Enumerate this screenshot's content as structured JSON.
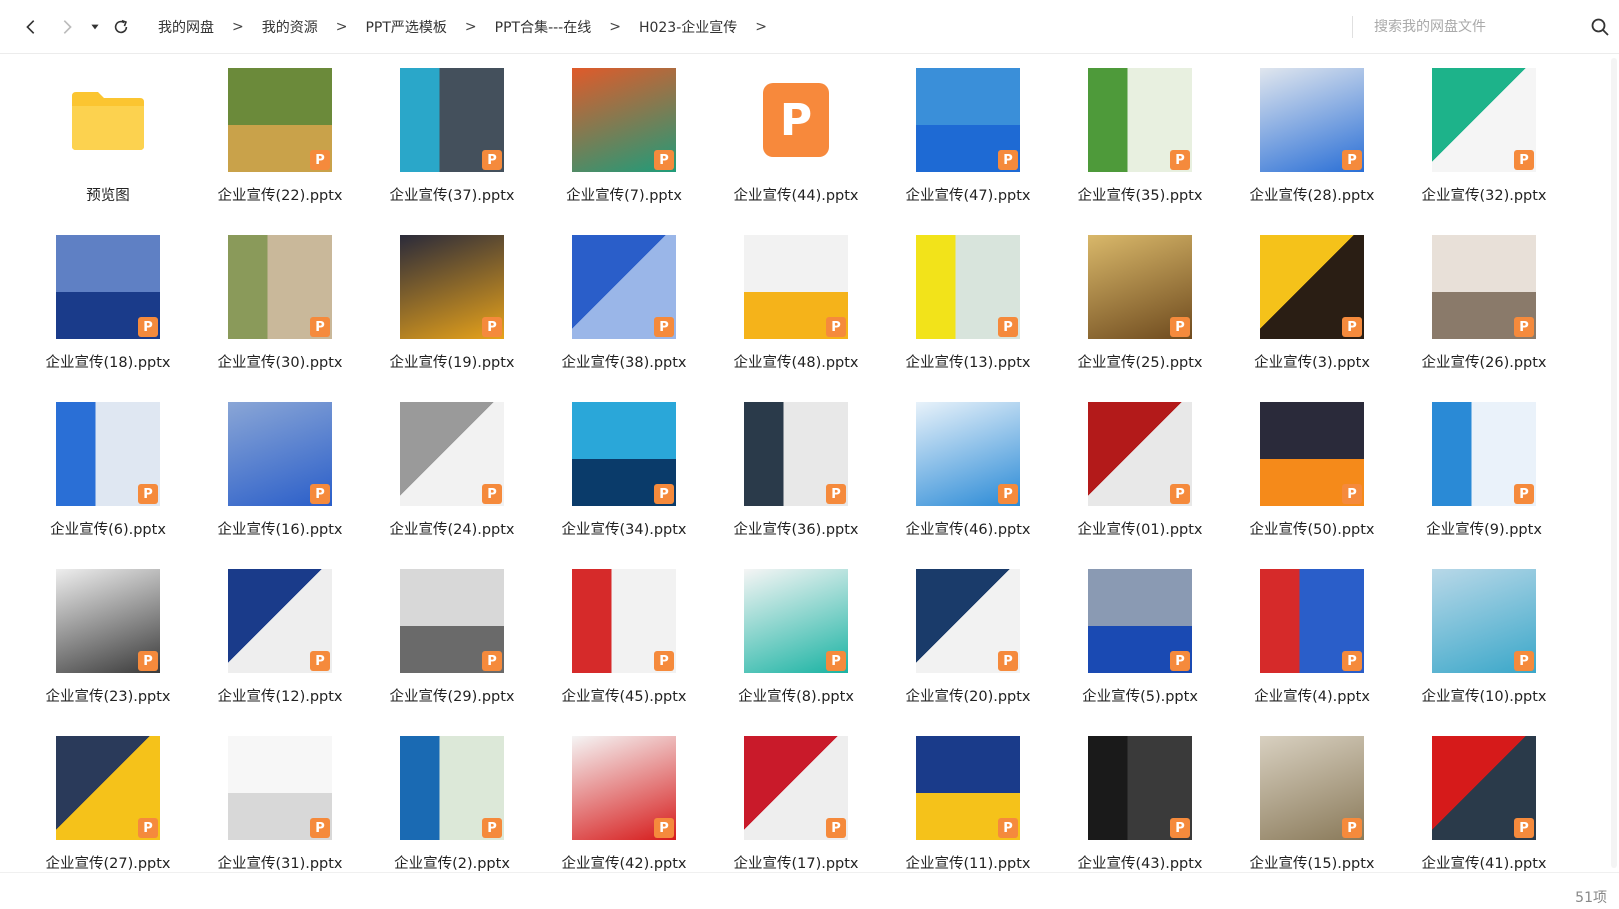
{
  "breadcrumb": [
    "我的网盘",
    "我的资源",
    "PPT严选模板",
    "PPT合集---在线",
    "H023-企业宣传"
  ],
  "breadcrumb_separator": ">",
  "search": {
    "placeholder": "搜索我的网盘文件"
  },
  "status": {
    "count": "51项"
  },
  "badge_letter": "P",
  "files": [
    {
      "name": "预览图",
      "kind": "folder"
    },
    {
      "name": "企业宣传(22).pptx",
      "c1": "#c9a24a",
      "c2": "#6b8a3a"
    },
    {
      "name": "企业宣传(37).pptx",
      "c1": "#2aa7c9",
      "c2": "#44505c"
    },
    {
      "name": "企业宣传(7).pptx",
      "c1": "#1f9c7a",
      "c2": "#e05a2a"
    },
    {
      "name": "企业宣传(44).pptx",
      "kind": "ppt-icon"
    },
    {
      "name": "企业宣传(47).pptx",
      "c1": "#1e6ad4",
      "c2": "#3a8fd9"
    },
    {
      "name": "企业宣传(35).pptx",
      "c1": "#4e9a3a",
      "c2": "#e8f0e0"
    },
    {
      "name": "企业宣传(28).pptx",
      "c1": "#2a6fd6",
      "c2": "#e0e6ee"
    },
    {
      "name": "企业宣传(32).pptx",
      "c1": "#1db38a",
      "c2": "#f5f5f5"
    },
    {
      "name": "企业宣传(18).pptx",
      "c1": "#1a3b8a",
      "c2": "#5f80c4"
    },
    {
      "name": "企业宣传(30).pptx",
      "c1": "#8a9a5a",
      "c2": "#c9b89a"
    },
    {
      "name": "企业宣传(19).pptx",
      "c1": "#e8a31a",
      "c2": "#2a2a3a"
    },
    {
      "name": "企业宣传(38).pptx",
      "c1": "#2a5ec9",
      "c2": "#9ab6e8"
    },
    {
      "name": "企业宣传(48).pptx",
      "c1": "#f5b31a",
      "c2": "#f2f2f2"
    },
    {
      "name": "企业宣传(13).pptx",
      "c1": "#f2e31a",
      "c2": "#d8e4dc"
    },
    {
      "name": "企业宣传(25).pptx",
      "c1": "#6e4a1e",
      "c2": "#d9b86a"
    },
    {
      "name": "企业宣传(3).pptx",
      "c1": "#f5c21a",
      "c2": "#2a1e14"
    },
    {
      "name": "企业宣传(26).pptx",
      "c1": "#8a7a6a",
      "c2": "#e8e0d8"
    },
    {
      "name": "企业宣传(6).pptx",
      "c1": "#2a6fd6",
      "c2": "#dfe7f2"
    },
    {
      "name": "企业宣传(16).pptx",
      "c1": "#2a5ec9",
      "c2": "#8aa6d6"
    },
    {
      "name": "企业宣传(24).pptx",
      "c1": "#9a9a9a",
      "c2": "#f2f2f2"
    },
    {
      "name": "企业宣传(34).pptx",
      "c1": "#0a3b6a",
      "c2": "#2aa7d9"
    },
    {
      "name": "企业宣传(36).pptx",
      "c1": "#2a3a4a",
      "c2": "#e8e8e8"
    },
    {
      "name": "企业宣传(46).pptx",
      "c1": "#2a8ad6",
      "c2": "#e8f2fa"
    },
    {
      "name": "企业宣传(01).pptx",
      "c1": "#b31a1a",
      "c2": "#e8e8e8"
    },
    {
      "name": "企业宣传(50).pptx",
      "c1": "#f58a1a",
      "c2": "#2a2a3a"
    },
    {
      "name": "企业宣传(9).pptx",
      "c1": "#2a8ad6",
      "c2": "#eaf2fa"
    },
    {
      "name": "企业宣传(23).pptx",
      "c1": "#3a3a3a",
      "c2": "#eeeeee"
    },
    {
      "name": "企业宣传(12).pptx",
      "c1": "#1a3b8a",
      "c2": "#eeeeee"
    },
    {
      "name": "企业宣传(29).pptx",
      "c1": "#6a6a6a",
      "c2": "#d8d8d8"
    },
    {
      "name": "企业宣传(45).pptx",
      "c1": "#d62a2a",
      "c2": "#f2f2f2"
    },
    {
      "name": "企业宣传(8).pptx",
      "c1": "#1ab3a3",
      "c2": "#f5f5f5"
    },
    {
      "name": "企业宣传(20).pptx",
      "c1": "#1a3b6a",
      "c2": "#f2f2f2"
    },
    {
      "name": "企业宣传(5).pptx",
      "c1": "#1a4ab3",
      "c2": "#8a9ab3"
    },
    {
      "name": "企业宣传(4).pptx",
      "c1": "#d62a2a",
      "c2": "#2a5ec9"
    },
    {
      "name": "企业宣传(10).pptx",
      "c1": "#3aa7c9",
      "c2": "#b8d8e8"
    },
    {
      "name": "企业宣传(27).pptx",
      "c1": "#2a3a5a",
      "c2": "#f5c21a"
    },
    {
      "name": "企业宣传(31).pptx",
      "c1": "#d8d8d8",
      "c2": "#f7f7f7"
    },
    {
      "name": "企业宣传(2).pptx",
      "c1": "#1a6ab3",
      "c2": "#dce8d8"
    },
    {
      "name": "企业宣传(42).pptx",
      "c1": "#d61a1a",
      "c2": "#f5f5f5"
    },
    {
      "name": "企业宣传(17).pptx",
      "c1": "#c91a2a",
      "c2": "#eeeeee"
    },
    {
      "name": "企业宣传(11).pptx",
      "c1": "#f5c21a",
      "c2": "#1a3b8a"
    },
    {
      "name": "企业宣传(43).pptx",
      "c1": "#1a1a1a",
      "c2": "#3a3a3a"
    },
    {
      "name": "企业宣传(15).pptx",
      "c1": "#8a7a5a",
      "c2": "#d8d0c0"
    },
    {
      "name": "企业宣传(41).pptx",
      "c1": "#d61a1a",
      "c2": "#2a3a4a"
    }
  ]
}
